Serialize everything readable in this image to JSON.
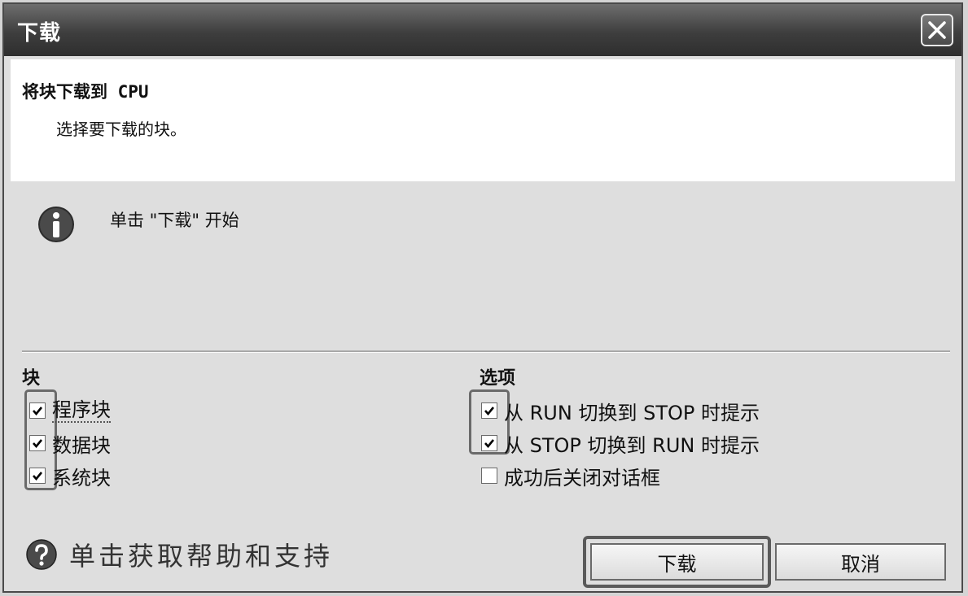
{
  "window": {
    "title": "下载",
    "close_icon": "close-icon"
  },
  "header": {
    "title": "将块下载到 CPU",
    "subtitle": "选择要下载的块。"
  },
  "info": {
    "icon": "info-icon",
    "text": "单击 \"下载\" 开始"
  },
  "blocks": {
    "title": "块",
    "items": [
      {
        "label": "程序块",
        "checked": true
      },
      {
        "label": "数据块",
        "checked": true
      },
      {
        "label": "系统块",
        "checked": true
      }
    ]
  },
  "options": {
    "title": "选项",
    "items": [
      {
        "label": "从 RUN 切换到 STOP 时提示",
        "checked": true
      },
      {
        "label": "从 STOP 切换到 RUN 时提示",
        "checked": true
      },
      {
        "label": "成功后关闭对话框",
        "checked": false
      }
    ]
  },
  "footer": {
    "help_icon": "help-icon",
    "help_text": "单击获取帮助和支持",
    "download_label": "下载",
    "cancel_label": "取消"
  }
}
